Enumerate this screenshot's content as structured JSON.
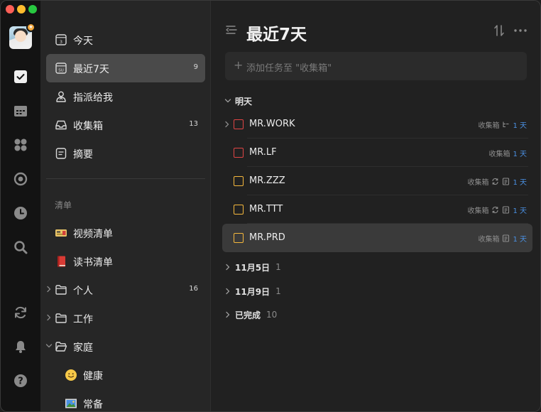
{
  "colors": {
    "accent": "#4a90e2",
    "priority_high": "#e04545",
    "priority_medium": "#f5b83d",
    "active_bg": "#4a4a4a",
    "selected_row_bg": "#3a3a3a"
  },
  "rail": {
    "icons": [
      "task-check-icon",
      "calendar-icon",
      "grid-apps-icon",
      "focus-target-icon",
      "clock-icon",
      "search-icon",
      "sync-icon",
      "bell-icon",
      "help-icon"
    ]
  },
  "sidebar": {
    "smart_lists": [
      {
        "label": "今天",
        "icon": "calendar-today-icon",
        "count": "",
        "day": "3"
      },
      {
        "label": "最近7天",
        "icon": "calendar-week-icon",
        "count": "9",
        "day": "SU"
      },
      {
        "label": "指派给我",
        "icon": "person-assigned-icon",
        "count": ""
      },
      {
        "label": "收集箱",
        "icon": "inbox-icon",
        "count": "13"
      },
      {
        "label": "摘要",
        "icon": "summary-icon",
        "count": ""
      }
    ],
    "lists_section": "清单",
    "lists": [
      {
        "label": "视频清单",
        "icon": "ticket-emoji-icon",
        "count": ""
      },
      {
        "label": "读书清单",
        "icon": "book-emoji-icon",
        "count": ""
      },
      {
        "label": "个人",
        "icon": "folder-icon",
        "count": "16"
      },
      {
        "label": "工作",
        "icon": "folder-icon",
        "count": ""
      },
      {
        "label": "家庭",
        "icon": "folder-open-icon",
        "count": ""
      }
    ],
    "sublists": [
      {
        "label": "健康",
        "icon": "smiley-emoji-icon"
      },
      {
        "label": "常备",
        "icon": "picture-emoji-icon"
      }
    ]
  },
  "main": {
    "title": "最近7天",
    "add_placeholder": "添加任务至 \"收集箱\"",
    "groups": [
      {
        "name": "明天",
        "count": "",
        "expanded": true,
        "tasks": [
          {
            "title": "MR.WORK",
            "priority": "high",
            "list": "收集箱",
            "icons": [
              "subtask-icon"
            ],
            "due": "1 天",
            "has_subtasks": true,
            "selected": false
          },
          {
            "title": "MR.LF",
            "priority": "high",
            "list": "收集箱",
            "icons": [],
            "due": "1 天",
            "has_subtasks": false,
            "selected": false
          },
          {
            "title": "MR.ZZZ",
            "priority": "medium",
            "list": "收集箱",
            "icons": [
              "repeat-icon",
              "note-icon"
            ],
            "due": "1 天",
            "has_subtasks": false,
            "selected": false
          },
          {
            "title": "MR.TTT",
            "priority": "medium",
            "list": "收集箱",
            "icons": [
              "repeat-icon",
              "note-icon"
            ],
            "due": "1 天",
            "has_subtasks": false,
            "selected": false
          },
          {
            "title": "MR.PRD",
            "priority": "medium",
            "list": "收集箱",
            "icons": [
              "note-icon"
            ],
            "due": "1 天",
            "has_subtasks": false,
            "selected": true
          }
        ]
      },
      {
        "name": "11月5日",
        "count": "1",
        "expanded": false
      },
      {
        "name": "11月9日",
        "count": "1",
        "expanded": false
      },
      {
        "name": "已完成",
        "count": "10",
        "expanded": false
      }
    ]
  }
}
